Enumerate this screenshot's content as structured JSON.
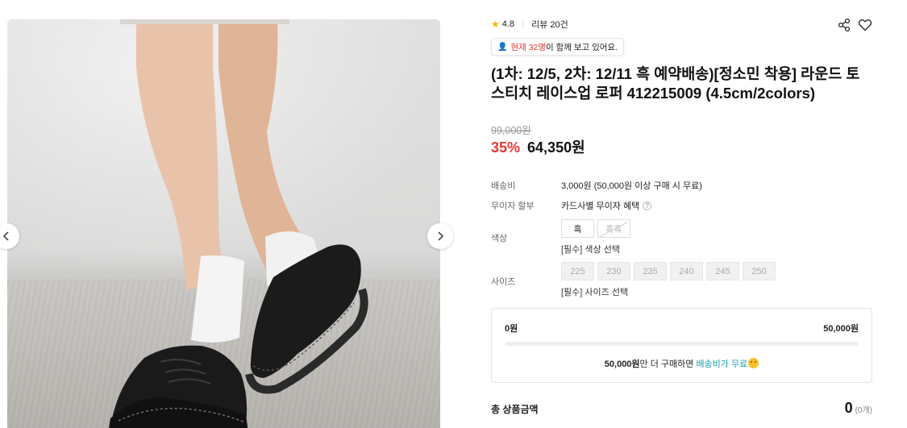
{
  "gallery": {
    "prev_label": "Previous image",
    "next_label": "Next image"
  },
  "rating": {
    "score": "4.8",
    "reviews": "리뷰 20건"
  },
  "viewers": {
    "highlight": "현재 32명",
    "rest": "이 함께 보고 있어요."
  },
  "product": {
    "title": "(1차: 12/5, 2차: 12/11 흑 예약배송)[정소민 착용] 라운드 토 스티치 레이스업 로퍼 412215009 (4.5cm/2colors)",
    "original_price": "99,000원",
    "discount": "35%",
    "price": "64,350원"
  },
  "shipping": {
    "label": "배송비",
    "value": "3,000원 (50,000원 이상 구매 시 무료)"
  },
  "installment": {
    "label": "무이자 할부",
    "value": "카드사별 무이자 혜택",
    "help": "?"
  },
  "color": {
    "label": "색상",
    "options": [
      "흑",
      "흑흑"
    ],
    "hint": "[필수] 색상 선택"
  },
  "size": {
    "label": "사이즈",
    "options": [
      "225",
      "230",
      "235",
      "240",
      "245",
      "250"
    ],
    "hint": "[필수] 사이즈 선택"
  },
  "free_shipping": {
    "current": "0원",
    "target": "50,000원",
    "progress": 0,
    "msg_amount": "50,000원",
    "msg_mid": "만 더 구매하면 ",
    "msg_end": "배송비가 무료"
  },
  "total": {
    "label": "총 상품금액",
    "value": "0",
    "count": "(0개)"
  },
  "colors": {
    "accent_red": "#e53935",
    "teal": "#1a9fa6",
    "star": "#f5b800"
  }
}
